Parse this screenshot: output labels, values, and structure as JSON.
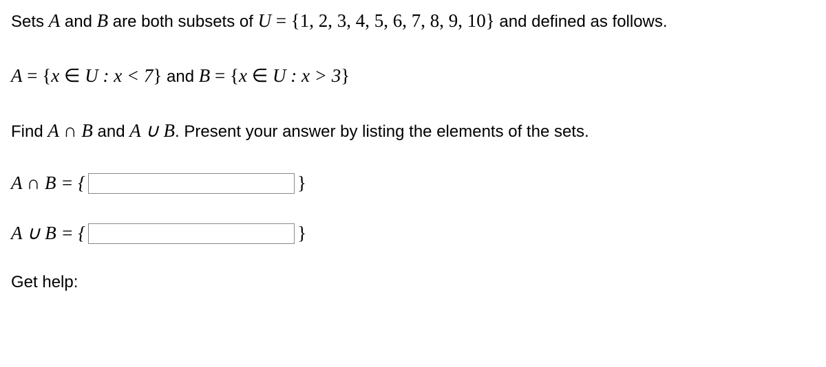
{
  "problem": {
    "line1_pre": "Sets ",
    "line1_A": "A",
    "line1_and": " and ",
    "line1_B": "B",
    "line1_mid": " are both subsets of ",
    "line1_U": "U",
    "line1_eq": " = ",
    "line1_set": "{1, 2, 3, 4, 5, 6, 7, 8, 9, 10}",
    "line1_post": " and defined as follows.",
    "line2_A": "A",
    "line2_eq1": " = ",
    "line2_setA_open": "{",
    "line2_setA_x": "x",
    "line2_setA_in": " ∈ ",
    "line2_setA_U": "U",
    "line2_setA_cond": " : x < 7",
    "line2_setA_close": "}",
    "line2_and": " and ",
    "line2_B": "B",
    "line2_eq2": " = ",
    "line2_setB_open": "{",
    "line2_setB_x": "x",
    "line2_setB_in": " ∈ ",
    "line2_setB_U": "U",
    "line2_setB_cond": " : x > 3",
    "line2_setB_close": "}",
    "line3_pre": "Find ",
    "line3_AcapB": "A ∩ B",
    "line3_and": " and ",
    "line3_AcupB": "A ∪ B",
    "line3_post": ". Present your answer by listing the elements of the sets.",
    "ans1_label": "A ∩ B = {",
    "ans1_close": "}",
    "ans2_label": "A ∪ B = {",
    "ans2_close": "}",
    "help": "Get help:"
  }
}
